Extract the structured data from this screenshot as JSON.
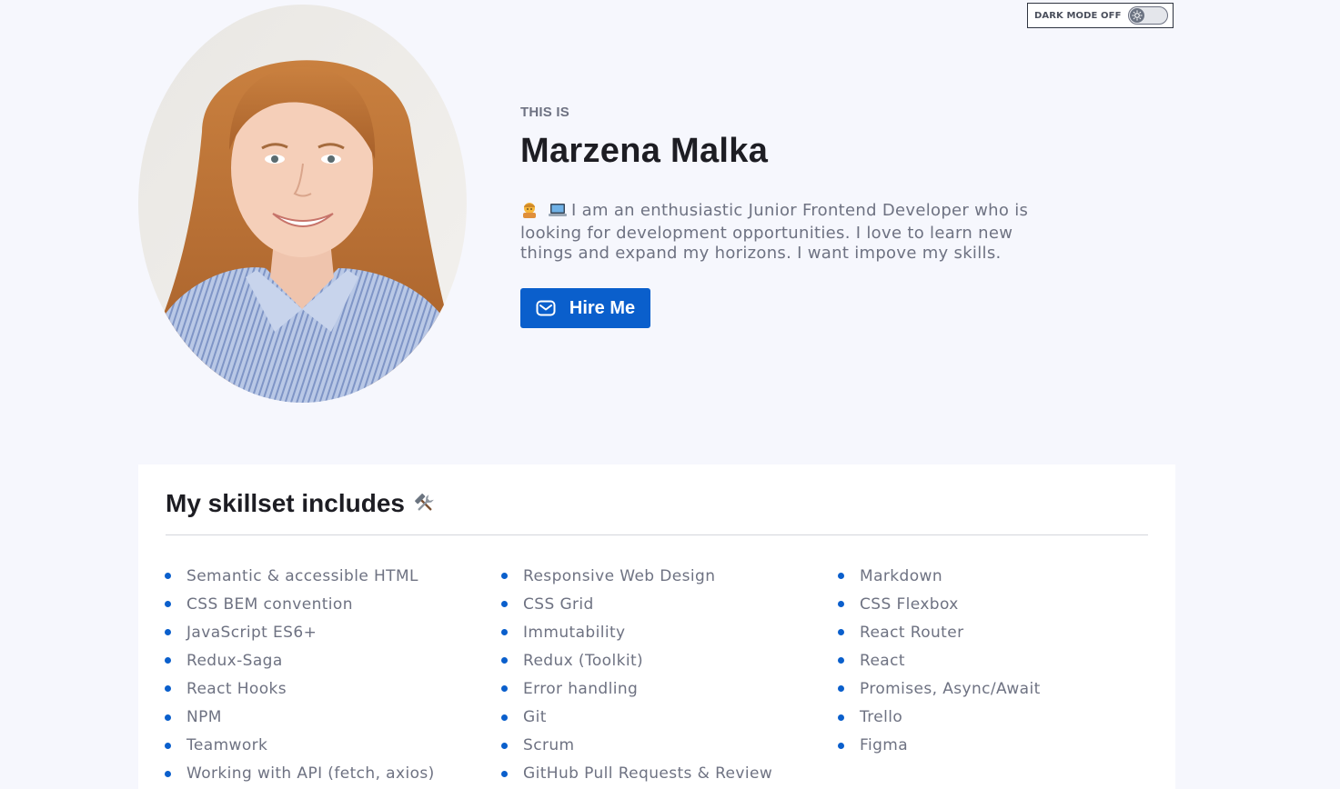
{
  "theme_toggle": {
    "label": "DARK MODE OFF",
    "knob_icon": "sun-icon"
  },
  "hero": {
    "photo_icon": "profile-photo",
    "eyebrow": "THIS IS",
    "name": "Marzena Malka",
    "intro_emojis": [
      "woman-technologist",
      "laptop"
    ],
    "intro": "I am an enthusiastic Junior Frontend Developer who is looking for development opportunities. I love to learn new things and expand my horizons. I want impove my skills.",
    "hire_button": "Hire Me",
    "hire_icon": "mail-icon"
  },
  "skills": {
    "title": "My skillset includes",
    "title_icon": "hammer-and-wrench-icon",
    "items": [
      "Semantic & accessible HTML",
      "CSS BEM convention",
      "JavaScript ES6+",
      "Redux-Saga",
      "React Hooks",
      "NPM",
      "Teamwork",
      "Working with API (fetch, axios)",
      "Responsive Web Design",
      "CSS Grid",
      "Immutability",
      "Redux (Toolkit)",
      "Error handling",
      "Git",
      "Scrum",
      "GitHub Pull Requests & Review",
      "Markdown",
      "CSS Flexbox",
      "React Router",
      "React",
      "Promises, Async/Await",
      "Trello",
      "Figma"
    ]
  },
  "colors": {
    "background": "#f6f7fd",
    "accent": "#0a5fcc",
    "heading": "#1d1d23",
    "muted_text": "#6e7282"
  }
}
